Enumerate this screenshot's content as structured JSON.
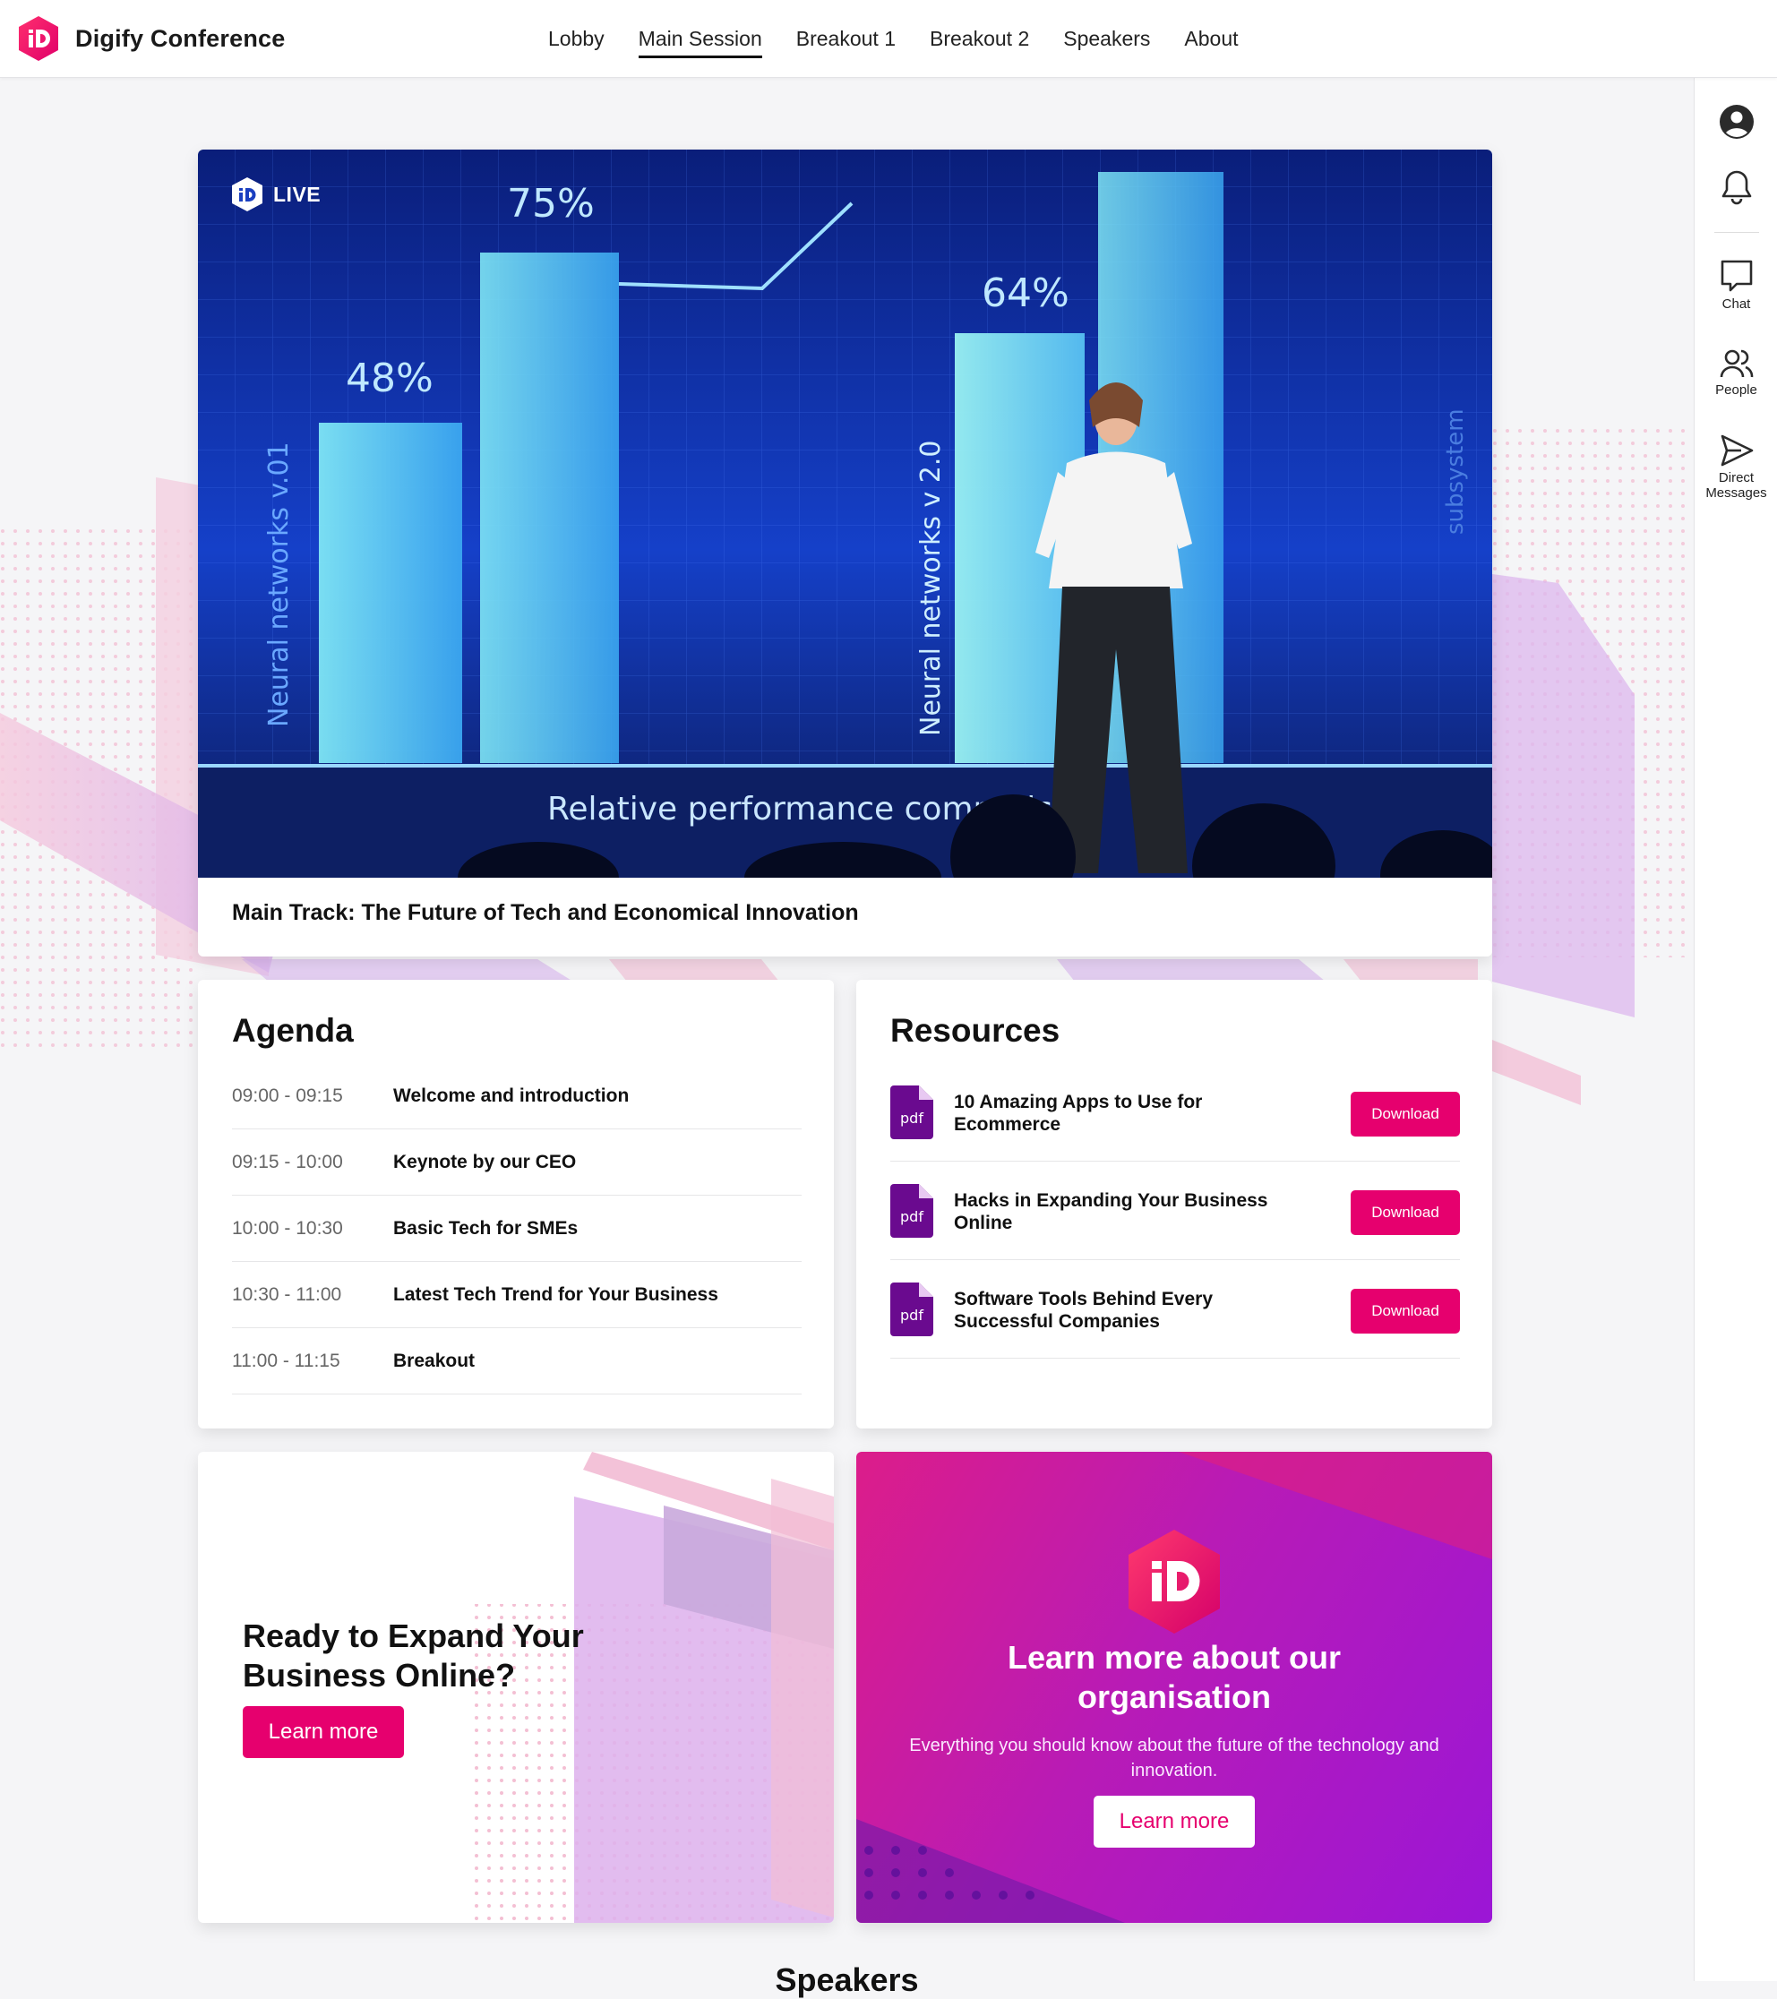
{
  "brand": {
    "name": "Digify Conference"
  },
  "nav": {
    "items": [
      {
        "label": "Lobby"
      },
      {
        "label": "Main Session"
      },
      {
        "label": "Breakout 1"
      },
      {
        "label": "Breakout 2"
      },
      {
        "label": "Speakers"
      },
      {
        "label": "About"
      }
    ],
    "active": "Main Session"
  },
  "rail": {
    "profile_icon": "user-circle-icon",
    "notification_icon": "bell-icon",
    "chat_label": "Chat",
    "people_label": "People",
    "dm_label_line1": "Direct",
    "dm_label_line2": "Messages"
  },
  "video": {
    "live_label": "LIVE",
    "title": "Main Track: The Future of Tech and Economical Innovation",
    "screen_text": {
      "pct_48": "48%",
      "pct_75": "75%",
      "pct_64": "64%",
      "axis_left": "Neural networks v.01",
      "axis_mid": "Neural networks v 2.0",
      "axis_right": "subsystem",
      "footer": "Relative performance comparis"
    }
  },
  "agenda": {
    "heading": "Agenda",
    "rows": [
      {
        "time": "09:00 - 09:15",
        "title": "Welcome and introduction"
      },
      {
        "time": "09:15 - 10:00",
        "title": "Keynote by our CEO"
      },
      {
        "time": "10:00 - 10:30",
        "title": "Basic Tech for SMEs"
      },
      {
        "time": "10:30 - 11:00",
        "title": "Latest Tech Trend  for Your Business"
      },
      {
        "time": "11:00 - 11:15",
        "title": "Breakout"
      }
    ]
  },
  "resources": {
    "heading": "Resources",
    "file_type": "pdf",
    "download_label": "Download",
    "items": [
      {
        "line1": "10 Amazing Apps to Use for",
        "line2": "Ecommerce"
      },
      {
        "line1": "Hacks in Expanding Your Business",
        "line2": "Online"
      },
      {
        "line1": "Software Tools Behind Every",
        "line2": "Successful Companies"
      }
    ]
  },
  "promo_left": {
    "line1": "Ready to Expand Your",
    "line2": "Business Online?",
    "button": "Learn more"
  },
  "promo_right": {
    "line1": "Learn more about our",
    "line2": "organisation",
    "body": "Everything you should know about the future of the technology and innovation.",
    "button": "Learn more"
  },
  "speakers_heading": "Speakers",
  "colors": {
    "accent": "#e6006e",
    "purple": "#9b16d6",
    "pdf_icon": "#6a0a8f"
  }
}
